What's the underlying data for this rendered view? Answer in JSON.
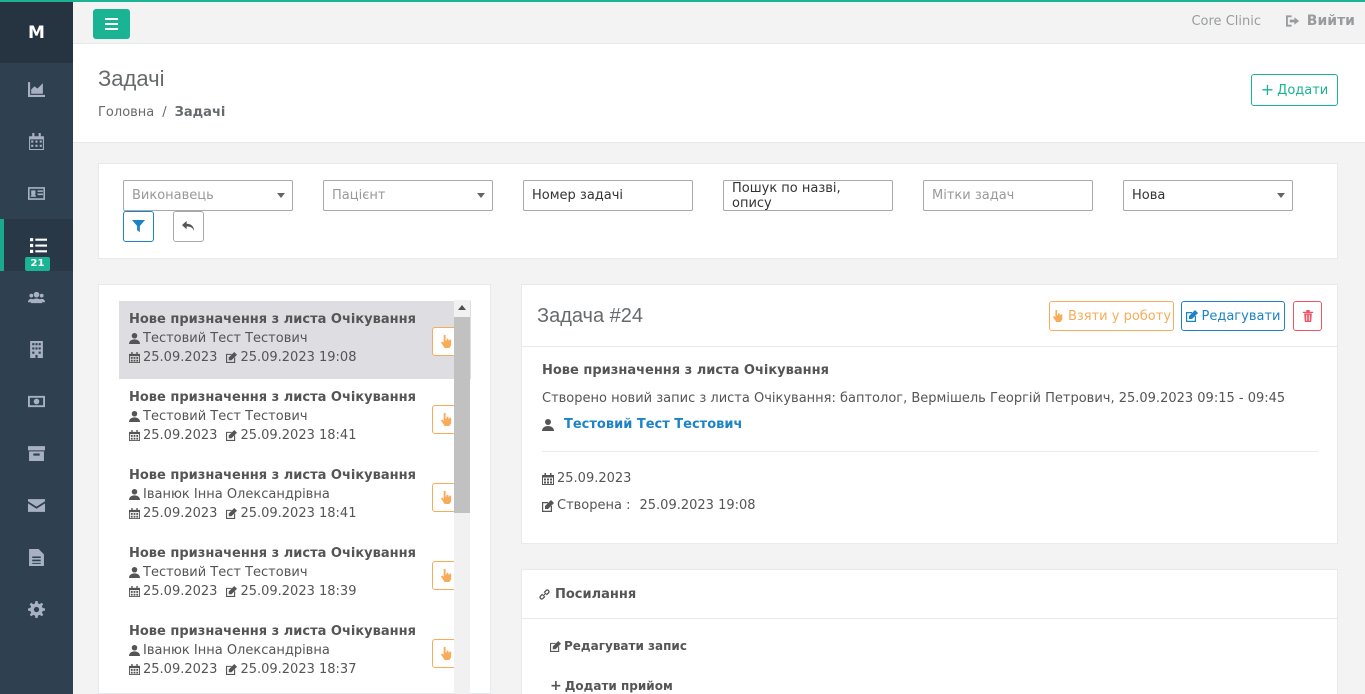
{
  "sidebar": {
    "logo": "M",
    "items": [
      {
        "icon": "chart-area-icon"
      },
      {
        "icon": "calendar-icon"
      },
      {
        "icon": "id-card-icon"
      },
      {
        "icon": "tasks-list-icon",
        "badge": "21",
        "active": true
      },
      {
        "icon": "users-icon"
      },
      {
        "icon": "building-icon"
      },
      {
        "icon": "money-icon"
      },
      {
        "icon": "archive-icon"
      },
      {
        "icon": "envelope-icon"
      },
      {
        "icon": "file-icon"
      },
      {
        "icon": "gear-icon"
      }
    ]
  },
  "topbar": {
    "clinic": "Core Clinic",
    "logout": "Вийти"
  },
  "header": {
    "title": "Задачі",
    "breadcrumb_home": "Головна",
    "breadcrumb_sep": "/",
    "breadcrumb_current": "Задачі",
    "add_label": "Додати"
  },
  "filters": {
    "executor_placeholder": "Виконавець",
    "patient_placeholder": "Пацієнт",
    "task_number": "Номер задачі",
    "search": "Пошук по назві, опису",
    "tags_placeholder": "Мітки задач",
    "status": "Нова"
  },
  "tasks": [
    {
      "title": "Нове призначення з листа Очікування",
      "person": "Тестовий Тест Тестович",
      "date": "25.09.2023",
      "edited": "25.09.2023 19:08"
    },
    {
      "title": "Нове призначення з листа Очікування",
      "person": "Тестовий Тест Тестович",
      "date": "25.09.2023",
      "edited": "25.09.2023 18:41"
    },
    {
      "title": "Нове призначення з листа Очікування",
      "person": "Іванюк Інна Олександрівна",
      "date": "25.09.2023",
      "edited": "25.09.2023 18:41"
    },
    {
      "title": "Нове призначення з листа Очікування",
      "person": "Тестовий Тест Тестович",
      "date": "25.09.2023",
      "edited": "25.09.2023 18:39"
    },
    {
      "title": "Нове призначення з листа Очікування",
      "person": "Іванюк Інна Олександрівна",
      "date": "25.09.2023",
      "edited": "25.09.2023 18:37"
    }
  ],
  "detail": {
    "heading": "Задача #24",
    "take_label": "Взяти у роботу",
    "edit_label": "Редагувати",
    "title": "Нове призначення з листа Очікування",
    "description": "Створено новий запис з листа Очікування: баптолог, Вермішель Георгій Петрович, 25.09.2023 09:15 - 09:45",
    "patient": "Тестовий Тест Тестович",
    "date": "25.09.2023",
    "created_label": "Створена :",
    "created_value": "25.09.2023 19:08"
  },
  "links": {
    "heading": "Посилання",
    "edit_record": "Редагувати запис",
    "add_appointment": "Додати прийом"
  }
}
